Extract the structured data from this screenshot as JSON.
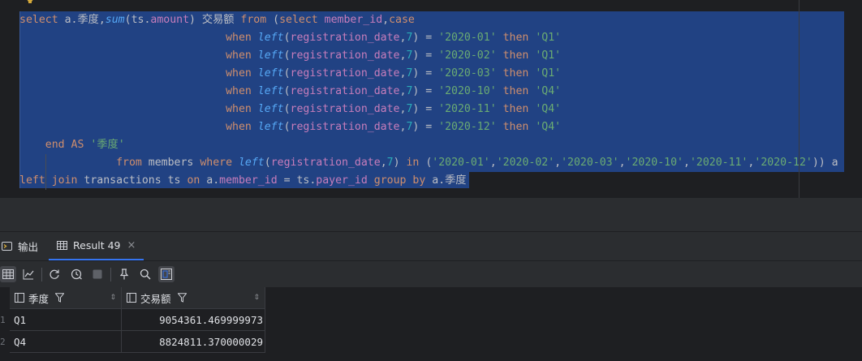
{
  "editor": {
    "lines": [
      [
        [
          "kw",
          "select"
        ],
        [
          "t",
          " a."
        ],
        [
          "t",
          "季度"
        ],
        [
          "t",
          ","
        ],
        [
          "fn",
          "sum"
        ],
        [
          "t",
          "(ts."
        ],
        [
          "fld",
          "amount"
        ],
        [
          "t",
          ") 交易额 "
        ],
        [
          "kw",
          "from"
        ],
        [
          "t",
          " ("
        ],
        [
          "kw",
          "select"
        ],
        [
          "t",
          " "
        ],
        [
          "fld",
          "member_id"
        ],
        [
          "t",
          ","
        ],
        [
          "kw",
          "case"
        ]
      ],
      [
        [
          "t",
          "                                "
        ],
        [
          "kw",
          "when"
        ],
        [
          "t",
          " "
        ],
        [
          "fn",
          "left"
        ],
        [
          "t",
          "("
        ],
        [
          "fld",
          "registration_date"
        ],
        [
          "t",
          ","
        ],
        [
          "num",
          "7"
        ],
        [
          "t",
          ") = "
        ],
        [
          "str",
          "'2020-01'"
        ],
        [
          "t",
          " "
        ],
        [
          "kw",
          "then"
        ],
        [
          "t",
          " "
        ],
        [
          "str",
          "'Q1'"
        ]
      ],
      [
        [
          "t",
          "                                "
        ],
        [
          "kw",
          "when"
        ],
        [
          "t",
          " "
        ],
        [
          "fn",
          "left"
        ],
        [
          "t",
          "("
        ],
        [
          "fld",
          "registration_date"
        ],
        [
          "t",
          ","
        ],
        [
          "num",
          "7"
        ],
        [
          "t",
          ") = "
        ],
        [
          "str",
          "'2020-02'"
        ],
        [
          "t",
          " "
        ],
        [
          "kw",
          "then"
        ],
        [
          "t",
          " "
        ],
        [
          "str",
          "'Q1'"
        ]
      ],
      [
        [
          "t",
          "                                "
        ],
        [
          "kw",
          "when"
        ],
        [
          "t",
          " "
        ],
        [
          "fn",
          "left"
        ],
        [
          "t",
          "("
        ],
        [
          "fld",
          "registration_date"
        ],
        [
          "t",
          ","
        ],
        [
          "num",
          "7"
        ],
        [
          "t",
          ") = "
        ],
        [
          "str",
          "'2020-03'"
        ],
        [
          "t",
          " "
        ],
        [
          "kw",
          "then"
        ],
        [
          "t",
          " "
        ],
        [
          "str",
          "'Q1'"
        ]
      ],
      [
        [
          "t",
          "                                "
        ],
        [
          "kw",
          "when"
        ],
        [
          "t",
          " "
        ],
        [
          "fn",
          "left"
        ],
        [
          "t",
          "("
        ],
        [
          "fld",
          "registration_date"
        ],
        [
          "t",
          ","
        ],
        [
          "num",
          "7"
        ],
        [
          "t",
          ") = "
        ],
        [
          "str",
          "'2020-10'"
        ],
        [
          "t",
          " "
        ],
        [
          "kw",
          "then"
        ],
        [
          "t",
          " "
        ],
        [
          "str",
          "'Q4'"
        ]
      ],
      [
        [
          "t",
          "                                "
        ],
        [
          "kw",
          "when"
        ],
        [
          "t",
          " "
        ],
        [
          "fn",
          "left"
        ],
        [
          "t",
          "("
        ],
        [
          "fld",
          "registration_date"
        ],
        [
          "t",
          ","
        ],
        [
          "num",
          "7"
        ],
        [
          "t",
          ") = "
        ],
        [
          "str",
          "'2020-11'"
        ],
        [
          "t",
          " "
        ],
        [
          "kw",
          "then"
        ],
        [
          "t",
          " "
        ],
        [
          "str",
          "'Q4'"
        ]
      ],
      [
        [
          "t",
          "                                "
        ],
        [
          "kw",
          "when"
        ],
        [
          "t",
          " "
        ],
        [
          "fn",
          "left"
        ],
        [
          "t",
          "("
        ],
        [
          "fld",
          "registration_date"
        ],
        [
          "t",
          ","
        ],
        [
          "num",
          "7"
        ],
        [
          "t",
          ") = "
        ],
        [
          "str",
          "'2020-12'"
        ],
        [
          "t",
          " "
        ],
        [
          "kw",
          "then"
        ],
        [
          "t",
          " "
        ],
        [
          "str",
          "'Q4'"
        ]
      ],
      [
        [
          "t",
          "    "
        ],
        [
          "kw",
          "end"
        ],
        [
          "t",
          " "
        ],
        [
          "kw",
          "AS"
        ],
        [
          "t",
          " "
        ],
        [
          "str",
          "'季度'"
        ]
      ],
      [
        [
          "t",
          "               "
        ],
        [
          "kw",
          "from"
        ],
        [
          "t",
          " members "
        ],
        [
          "kw",
          "where"
        ],
        [
          "t",
          " "
        ],
        [
          "fn",
          "left"
        ],
        [
          "t",
          "("
        ],
        [
          "fld",
          "registration_date"
        ],
        [
          "t",
          ","
        ],
        [
          "num",
          "7"
        ],
        [
          "t",
          ") "
        ],
        [
          "kw",
          "in"
        ],
        [
          "t",
          " ("
        ],
        [
          "str",
          "'2020-01'"
        ],
        [
          "t",
          ","
        ],
        [
          "str",
          "'2020-02'"
        ],
        [
          "t",
          ","
        ],
        [
          "str",
          "'2020-03'"
        ],
        [
          "t",
          ","
        ],
        [
          "str",
          "'2020-10'"
        ],
        [
          "t",
          ","
        ],
        [
          "str",
          "'2020-11'"
        ],
        [
          "t",
          ","
        ],
        [
          "str",
          "'2020-12'"
        ],
        [
          "t",
          ")) a"
        ]
      ],
      [
        [
          "kw",
          "left join"
        ],
        [
          "t",
          " transactions ts "
        ],
        [
          "kw",
          "on"
        ],
        [
          "t",
          " a."
        ],
        [
          "fld",
          "member_id"
        ],
        [
          "t",
          " = ts."
        ],
        [
          "fld",
          "payer_id"
        ],
        [
          "t",
          " "
        ],
        [
          "kw",
          "group by"
        ],
        [
          "t",
          " a."
        ],
        [
          "t",
          "季度"
        ]
      ]
    ]
  },
  "tabs": {
    "output_label": "输出",
    "result_label": "Result 49",
    "close_glyph": "×"
  },
  "toolbar": {
    "icons": [
      "table-view-icon",
      "chart-view-icon",
      "refresh-icon",
      "history-icon",
      "stop-icon",
      "pin-icon",
      "search-icon",
      "layout-toggle-icon"
    ]
  },
  "grid": {
    "columns": [
      {
        "label": "季度",
        "sort_glyph": "⇕"
      },
      {
        "label": "交易额",
        "sort_glyph": "⇕"
      }
    ],
    "rows": [
      {
        "num": "1",
        "cells": [
          "Q1",
          "9054361.469999973"
        ]
      },
      {
        "num": "2",
        "cells": [
          "Q4",
          "8824811.370000029"
        ]
      }
    ]
  },
  "colors": {
    "selection": "#214283",
    "keyword": "#cf8e6d",
    "function": "#56a8f5",
    "field": "#c77dbb",
    "string": "#6aab73",
    "number": "#2aacb8",
    "accent": "#3574f0"
  }
}
